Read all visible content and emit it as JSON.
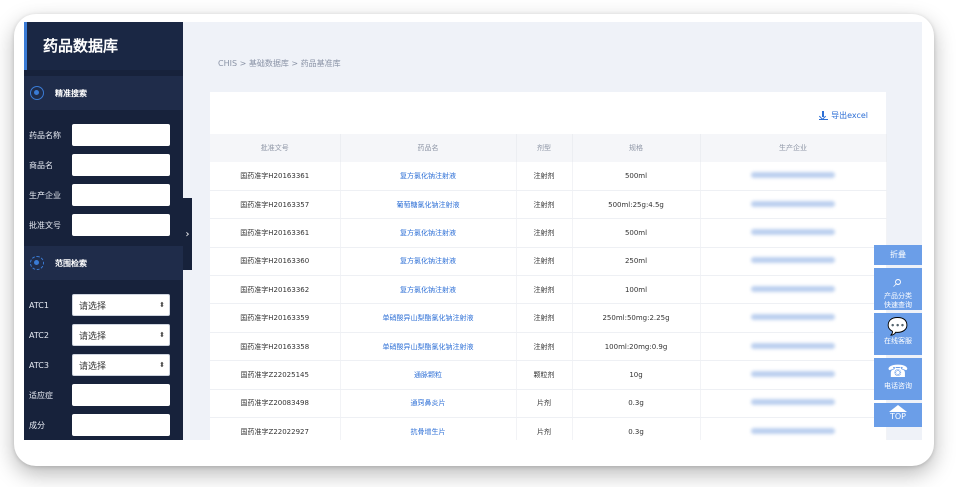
{
  "sidebar": {
    "title": "药品数据库",
    "precise_section": "精准搜索",
    "precise_fields": [
      {
        "label": "药品名称",
        "value": ""
      },
      {
        "label": "商品名",
        "value": ""
      },
      {
        "label": "生产企业",
        "value": ""
      },
      {
        "label": "批准文号",
        "value": ""
      }
    ],
    "range_section": "范围检索",
    "range_fields": [
      {
        "label": "ATC1",
        "value": "请选择"
      },
      {
        "label": "ATC2",
        "value": "请选择"
      },
      {
        "label": "ATC3",
        "value": "请选择"
      },
      {
        "label": "适应症",
        "value": ""
      },
      {
        "label": "成分",
        "value": ""
      }
    ],
    "collapse_glyph": "›"
  },
  "breadcrumb": "CHIS > 基础数据库 > 药品基准库",
  "export_label": "导出excel",
  "table": {
    "columns": [
      "批准文号",
      "药品名",
      "剂型",
      "规格",
      "生产企业"
    ],
    "rows": [
      [
        "国药准字H20163361",
        "复方氯化钠注射液",
        "注射剂",
        "500ml"
      ],
      [
        "国药准字H20163357",
        "葡萄糖氯化钠注射液",
        "注射剂",
        "500ml:25g:4.5g"
      ],
      [
        "国药准字H20163361",
        "复方氯化钠注射液",
        "注射剂",
        "500ml"
      ],
      [
        "国药准字H20163360",
        "复方氯化钠注射液",
        "注射剂",
        "250ml"
      ],
      [
        "国药准字H20163362",
        "复方氯化钠注射液",
        "注射剂",
        "100ml"
      ],
      [
        "国药准字H20163359",
        "单硝酸异山梨酯氯化钠注射液",
        "注射剂",
        "250ml:50mg:2.25g"
      ],
      [
        "国药准字H20163358",
        "单硝酸异山梨酯氯化钠注射液",
        "注射剂",
        "100ml:20mg:0.9g"
      ],
      [
        "国药准字Z22025145",
        "通脉颗粒",
        "颗粒剂",
        "10g"
      ],
      [
        "国药准字Z20083498",
        "通窍鼻炎片",
        "片剂",
        "0.3g"
      ],
      [
        "国药准字Z22022927",
        "抗骨增生片",
        "片剂",
        "0.3g"
      ]
    ]
  },
  "tools": {
    "fold": "折叠",
    "search_line1": "产品分类",
    "search_line2": "快速查询",
    "service": "在线客服",
    "phone": "电话咨询",
    "top": "TOP"
  },
  "colors": {
    "sidebar": "#17223b",
    "accent": "#2d6fd6",
    "tool": "#6b9ee8"
  }
}
